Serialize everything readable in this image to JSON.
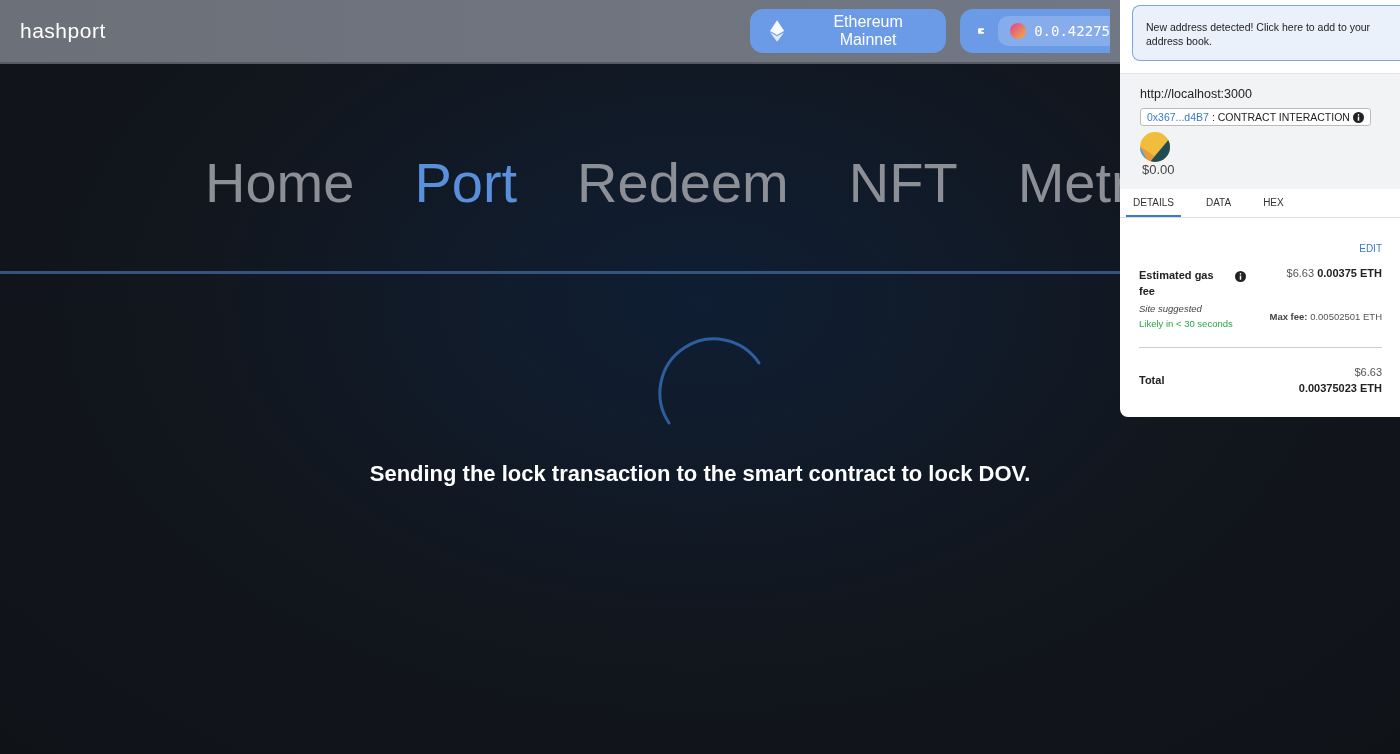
{
  "header": {
    "logo": "hashport",
    "network": "Ethereum Mainnet",
    "balance": "0.0.42275"
  },
  "nav": [
    {
      "label": "Home",
      "selected": false
    },
    {
      "label": "Port",
      "selected": true
    },
    {
      "label": "Redeem",
      "selected": false
    },
    {
      "label": "NFT",
      "selected": false
    },
    {
      "label": "Metr",
      "selected": false
    }
  ],
  "status": {
    "message": "Sending the lock transaction to the smart contract to lock DOV."
  },
  "wallet_popup": {
    "notice": "New address detected! Click here to add to your address book.",
    "origin": "http://localhost:3000",
    "address": "0x367...d4B7",
    "method": ": CONTRACT INTERACTION",
    "amount": "$0.00",
    "tabs": [
      {
        "label": "DETAILS",
        "selected": true
      },
      {
        "label": "DATA",
        "selected": false
      },
      {
        "label": "HEX",
        "selected": false
      }
    ],
    "edit": "EDIT",
    "gas_label": "Estimated gas fee",
    "gas_usd": "$6.63",
    "gas_eth": "0.00375 ETH",
    "site_suggested": "Site suggested",
    "likely": "Likely in < 30 seconds",
    "max_fee_label": "Max fee:",
    "max_fee": "0.00502501 ETH",
    "total_label": "Total",
    "total_usd": "$6.63",
    "total_eth": "0.00375023 ETH"
  }
}
